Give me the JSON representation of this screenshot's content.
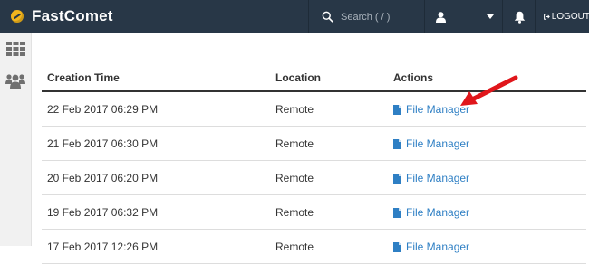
{
  "brand": {
    "name": "FastComet"
  },
  "header": {
    "search_placeholder": "Search ( / )",
    "logout_label": "LOGOUT"
  },
  "table": {
    "headers": [
      "Creation Time",
      "Location",
      "Actions"
    ],
    "rows": [
      {
        "time": "22 Feb 2017 06:29 PM",
        "location": "Remote",
        "action": "File Manager"
      },
      {
        "time": "21 Feb 2017 06:30 PM",
        "location": "Remote",
        "action": "File Manager"
      },
      {
        "time": "20 Feb 2017 06:20 PM",
        "location": "Remote",
        "action": "File Manager"
      },
      {
        "time": "19 Feb 2017 06:32 PM",
        "location": "Remote",
        "action": "File Manager"
      },
      {
        "time": "17 Feb 2017 12:26 PM",
        "location": "Remote",
        "action": "File Manager"
      }
    ]
  },
  "colors": {
    "topbar": "#283747",
    "link": "#2e7fc4",
    "annotation_arrow": "#e0161b",
    "logo_accent": "#f3b51d"
  }
}
